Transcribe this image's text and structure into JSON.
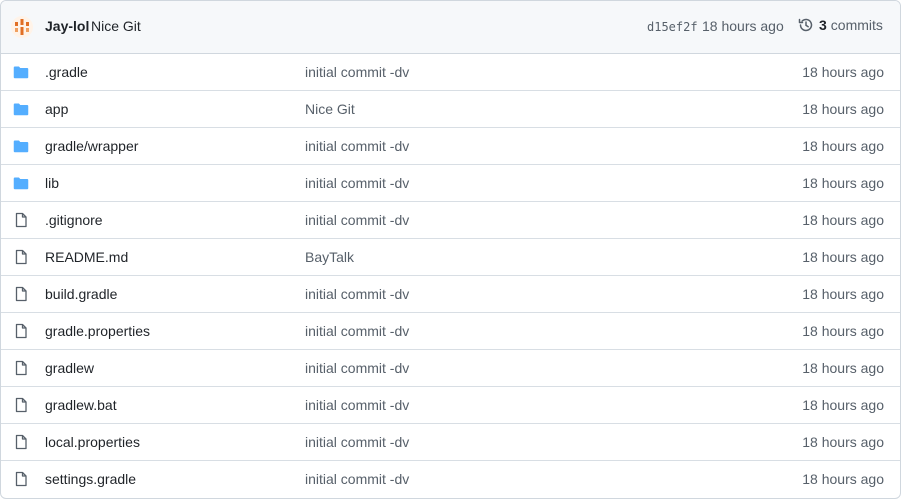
{
  "header": {
    "author": "Jay-lol",
    "message": "Nice Git",
    "sha": "d15ef2f",
    "time": "18 hours ago",
    "commit_count": "3",
    "commit_label": "commits"
  },
  "colors": {
    "folder": "#54aeff",
    "file": "#57606a",
    "avatar": "#e16f24"
  },
  "files": [
    {
      "name": ".gradle",
      "type": "folder",
      "message": "initial commit -dv",
      "time": "18 hours ago"
    },
    {
      "name": "app",
      "type": "folder",
      "message": "Nice Git",
      "time": "18 hours ago"
    },
    {
      "name": "gradle/wrapper",
      "type": "folder",
      "message": "initial commit -dv",
      "time": "18 hours ago"
    },
    {
      "name": "lib",
      "type": "folder",
      "message": "initial commit -dv",
      "time": "18 hours ago"
    },
    {
      "name": ".gitignore",
      "type": "file",
      "message": "initial commit -dv",
      "time": "18 hours ago"
    },
    {
      "name": "README.md",
      "type": "file",
      "message": "BayTalk",
      "time": "18 hours ago"
    },
    {
      "name": "build.gradle",
      "type": "file",
      "message": "initial commit -dv",
      "time": "18 hours ago"
    },
    {
      "name": "gradle.properties",
      "type": "file",
      "message": "initial commit -dv",
      "time": "18 hours ago"
    },
    {
      "name": "gradlew",
      "type": "file",
      "message": "initial commit -dv",
      "time": "18 hours ago"
    },
    {
      "name": "gradlew.bat",
      "type": "file",
      "message": "initial commit -dv",
      "time": "18 hours ago"
    },
    {
      "name": "local.properties",
      "type": "file",
      "message": "initial commit -dv",
      "time": "18 hours ago"
    },
    {
      "name": "settings.gradle",
      "type": "file",
      "message": "initial commit -dv",
      "time": "18 hours ago"
    }
  ]
}
